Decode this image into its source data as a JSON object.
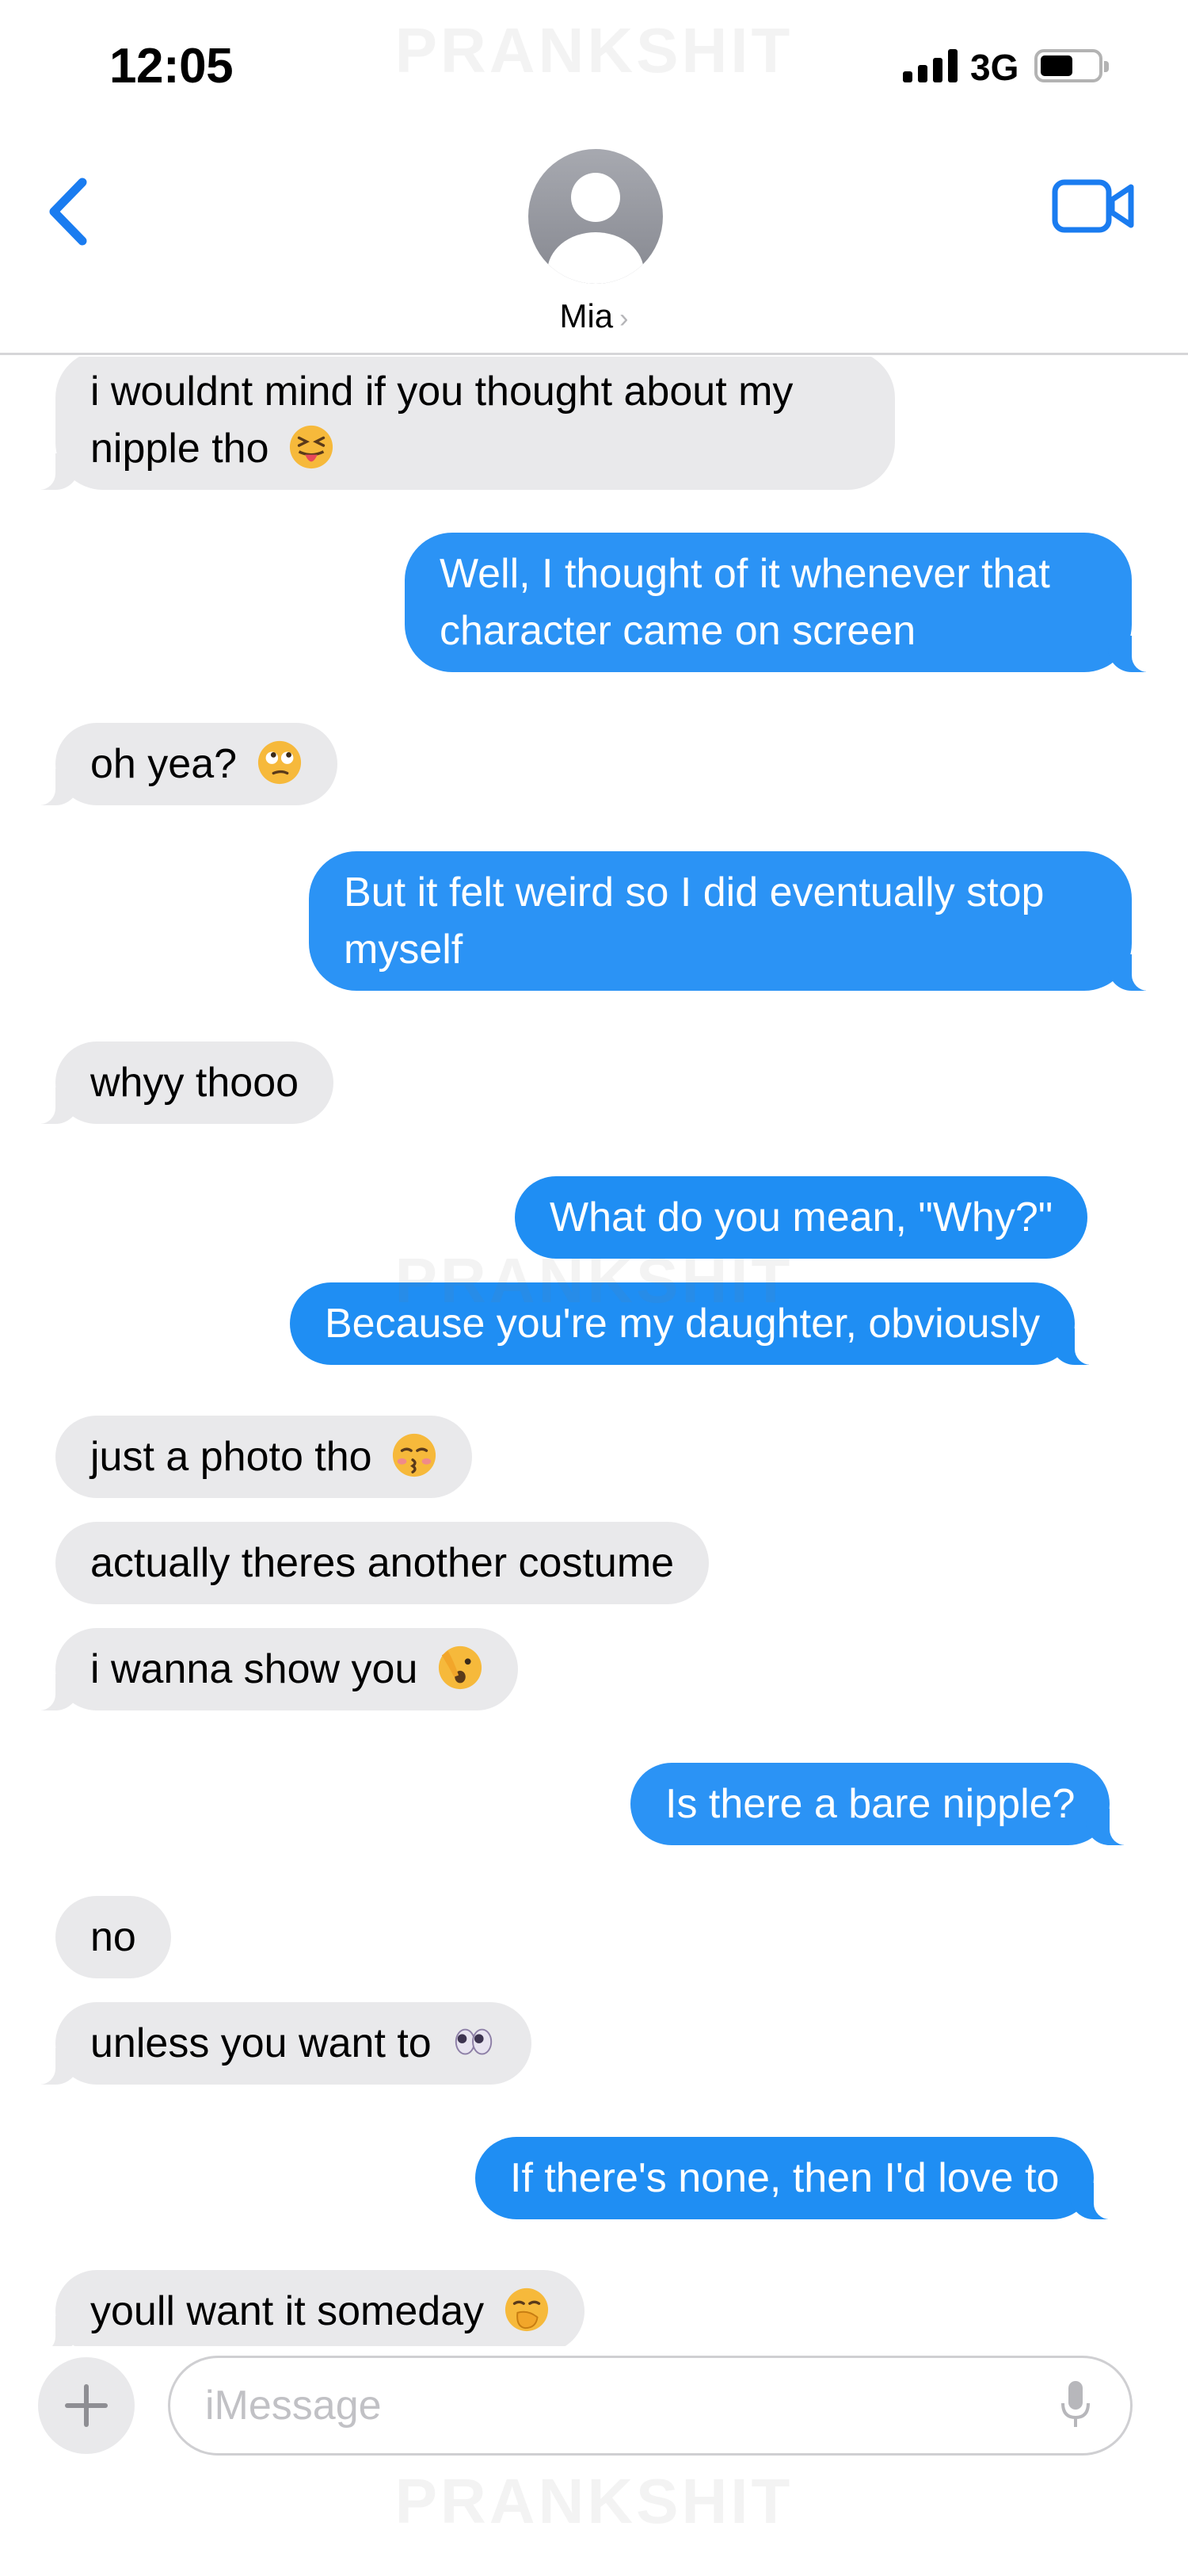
{
  "status_bar": {
    "time": "12:05",
    "network": "3G"
  },
  "watermark": "PRANKSHIT",
  "header": {
    "contact_name": "Mia",
    "chevron": "›"
  },
  "icons": [
    "chevron-left-icon",
    "video-camera-icon",
    "contact-avatar-icon",
    "plus-icon",
    "microphone-icon"
  ],
  "colors": {
    "accent": "#1a7cf0",
    "outgoing_bubble": "#1f8ef3",
    "incoming_bubble": "#e9e9eb"
  },
  "messages": [
    {
      "dir": "in",
      "text": "i wouldnt mind if you thought about my nipple tho",
      "emoji": "squinting-tongue-emoji"
    },
    {
      "dir": "out",
      "text": "Well, I thought of it whenever that character came on screen"
    },
    {
      "dir": "in",
      "text": "oh yea?",
      "emoji": "rolling-eyes-emoji"
    },
    {
      "dir": "out",
      "text": "But it felt weird so I did eventually stop myself"
    },
    {
      "dir": "in",
      "text": "whyy thooo"
    },
    {
      "dir": "out",
      "text": "What do you mean, \"Why?\""
    },
    {
      "dir": "out",
      "text": "Because you're my daughter, obviously"
    },
    {
      "dir": "in",
      "text": "just a photo tho",
      "emoji": "kissing-emoji"
    },
    {
      "dir": "in",
      "text": "actually theres another costume"
    },
    {
      "dir": "in",
      "text": "i wanna show you",
      "emoji": "peeking-face-emoji"
    },
    {
      "dir": "out",
      "text": "Is there a bare nipple?"
    },
    {
      "dir": "in",
      "text": "no"
    },
    {
      "dir": "in",
      "text": "unless you want to",
      "emoji": "eyes-emoji"
    },
    {
      "dir": "out",
      "text": "If there's none, then I'd love to"
    },
    {
      "dir": "in",
      "text": "youll want it someday",
      "emoji": "face-with-hand-over-mouth-emoji"
    }
  ],
  "composer": {
    "placeholder": "iMessage"
  }
}
